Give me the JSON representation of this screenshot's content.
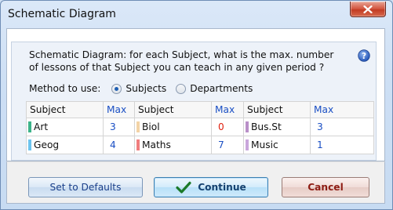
{
  "window": {
    "title": "Schematic Diagram",
    "close_glyph": "X"
  },
  "prompt": {
    "text": "Schematic Diagram: for each Subject, what is the max. number of lessons of that Subject you can teach in any given period ?"
  },
  "method": {
    "label": "Method to use:",
    "options": [
      {
        "label": "Subjects",
        "selected": true
      },
      {
        "label": "Departments",
        "selected": false
      }
    ]
  },
  "grid": {
    "headers": {
      "subject": "Subject",
      "max": "Max"
    },
    "rows": [
      [
        {
          "subject": "Art",
          "max": "3",
          "swatch": "#3cb38a",
          "max_color": "blue"
        },
        {
          "subject": "Biol",
          "max": "0",
          "swatch": "#f3d3a6",
          "max_color": "red"
        },
        {
          "subject": "Bus.St",
          "max": "3",
          "swatch": "#b98fc8",
          "max_color": "blue"
        }
      ],
      [
        {
          "subject": "Geog",
          "max": "4",
          "swatch": "#6cc4ef",
          "max_color": "blue"
        },
        {
          "subject": "Maths",
          "max": "7",
          "swatch": "#f07d7d",
          "max_color": "blue"
        },
        {
          "subject": "Music",
          "max": "1",
          "swatch": "#c9a6dc",
          "max_color": "blue"
        }
      ]
    ]
  },
  "buttons": {
    "defaults": "Set to Defaults",
    "continue": "Continue",
    "cancel": "Cancel"
  },
  "colors": {
    "accent_blue": "#1a4fc4",
    "zero_red": "#e02010"
  },
  "icons": {
    "help": "help-icon",
    "close": "close-icon",
    "check": "check-icon"
  }
}
